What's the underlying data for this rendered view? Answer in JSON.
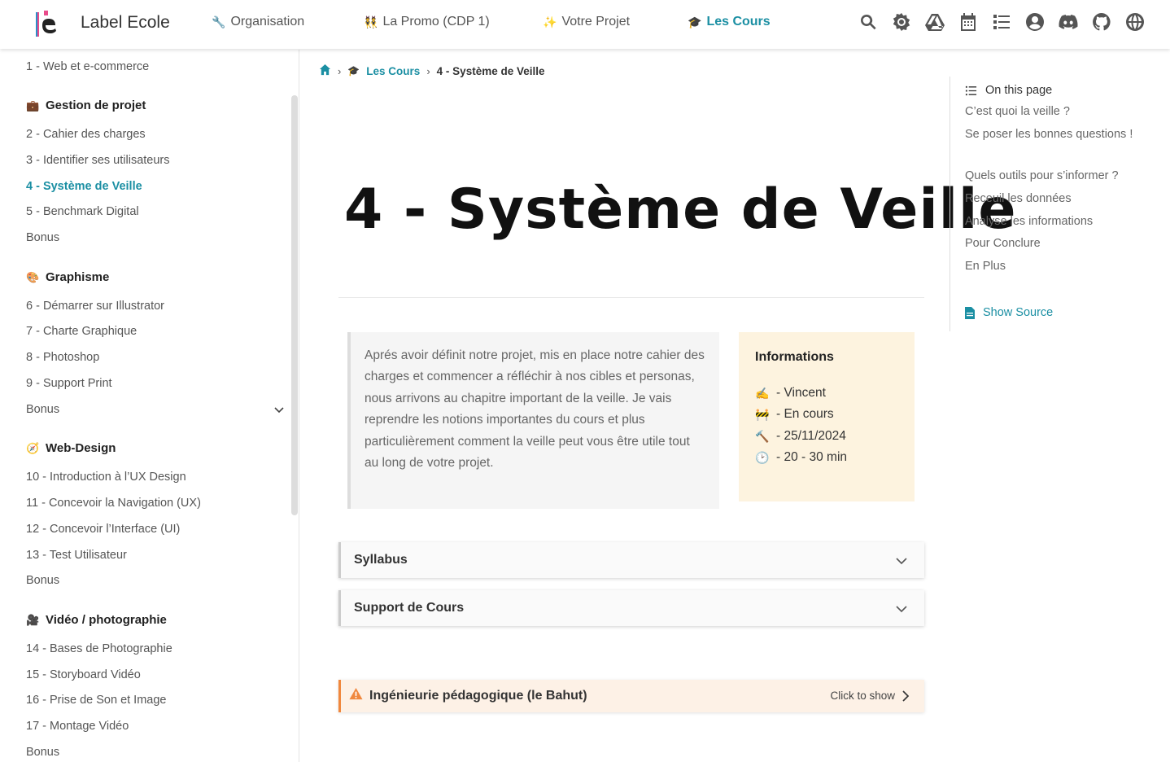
{
  "header": {
    "brand": "Label Ecole",
    "nav": [
      {
        "emoji": "🔧",
        "label": "Organisation"
      },
      {
        "emoji": "👯",
        "label": "La Promo (CDP 1)"
      },
      {
        "emoji": "✨",
        "label": "Votre Projet"
      },
      {
        "emoji": "🎓",
        "label": "Les Cours"
      }
    ],
    "icons": [
      "search-icon",
      "brightness-icon",
      "google-drive-icon",
      "calendar-icon",
      "list-icon",
      "user-icon",
      "discord-icon",
      "github-icon",
      "globe-icon"
    ]
  },
  "sidebar": {
    "top_item": "1 - Web et e-commerce",
    "sections": [
      {
        "emoji": "💼",
        "title": "Gestion de projet",
        "items": [
          "2 - Cahier des charges",
          "3 - Identifier ses utilisateurs",
          "4 - Système de Veille",
          "5 - Benchmark Digital",
          "Bonus"
        ]
      },
      {
        "emoji": "🎨",
        "title": "Graphisme",
        "items": [
          "6 - Démarrer sur Illustrator",
          "7 - Charte Graphique",
          "8 - Photoshop",
          "9 - Support Print",
          "Bonus"
        ]
      },
      {
        "emoji": "🧭",
        "title": "Web-Design",
        "items": [
          "10 - Introduction à l’UX Design",
          "11 - Concevoir la Navigation (UX)",
          "12 - Concevoir l’Interface (UI)",
          "13 - Test Utilisateur",
          "Bonus"
        ]
      },
      {
        "emoji": "🎥",
        "title": "Vidéo / photographie",
        "items": [
          "14 - Bases de Photographie",
          "15 - Storyboard Vidéo",
          "16 - Prise de Son et Image",
          "17 - Montage Vidéo",
          "Bonus"
        ]
      }
    ]
  },
  "breadcrumb": {
    "emoji": "🎓",
    "parent": "Les Cours",
    "current": "4 - Système de Veille"
  },
  "page": {
    "title": "4 - Système de Veille",
    "intro": "Aprés avoir définit notre projet, mis en place notre cahier des charges et commencer a réfléchir à nos cibles et personas, nous arrivons au chapitre important de la veille. Je vais reprendre les notions importantes du cours et plus particulièrement comment la veille peut vous être utile tout au long de votre projet.",
    "info": {
      "title": "Informations",
      "rows": [
        {
          "emoji": "✍️",
          "text": "- Vincent"
        },
        {
          "emoji": "🚧",
          "text": "- En cours"
        },
        {
          "emoji": "🔨",
          "text": "- 25/11/2024"
        },
        {
          "emoji": "🕑",
          "text": "- 20 - 30 min"
        }
      ]
    },
    "dropdowns": [
      "Syllabus",
      "Support de Cours"
    ],
    "admonition": {
      "label": "Ingénieurie pédagogique (le Bahut)",
      "action": "Click to show"
    }
  },
  "toc": {
    "heading": "On this page",
    "items": [
      "C’est quoi la veille ?",
      "Se poser les bonnes questions !",
      "Quels outils pour s’informer ?",
      "Receuil les données",
      "Analyse les informations",
      "Pour Conclure",
      "En Plus"
    ],
    "source": "Show Source"
  },
  "colors": {
    "accent": "#1b8fa3",
    "info_bg": "#fdf3df",
    "warning": "#f0883e"
  }
}
